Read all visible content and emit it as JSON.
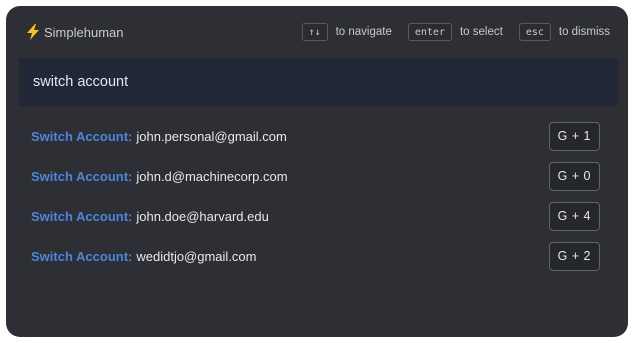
{
  "app": {
    "name": "Simplehuman",
    "icon": "lightning-bolt-icon",
    "accent_color": "#f5c518"
  },
  "hints": [
    {
      "key": "↑↓",
      "text": "to navigate"
    },
    {
      "key": "enter",
      "text": "to select"
    },
    {
      "key": "esc",
      "text": "to dismiss"
    }
  ],
  "search": {
    "value": "switch account",
    "placeholder": ""
  },
  "results": [
    {
      "label": "Switch Account:",
      "value": "john.personal@gmail.com",
      "shortcut": "G + 1"
    },
    {
      "label": "Switch Account:",
      "value": "john.d@machinecorp.com",
      "shortcut": "G + 0"
    },
    {
      "label": "Switch Account:",
      "value": "john.doe@harvard.edu",
      "shortcut": "G + 4"
    },
    {
      "label": "Switch Account:",
      "value": "wedidtjo@gmail.com",
      "shortcut": "G + 2"
    }
  ],
  "colors": {
    "background": "#2d2f34",
    "search_background": "#222737",
    "label_blue": "#4c86dc",
    "text": "#e6e8eb"
  }
}
